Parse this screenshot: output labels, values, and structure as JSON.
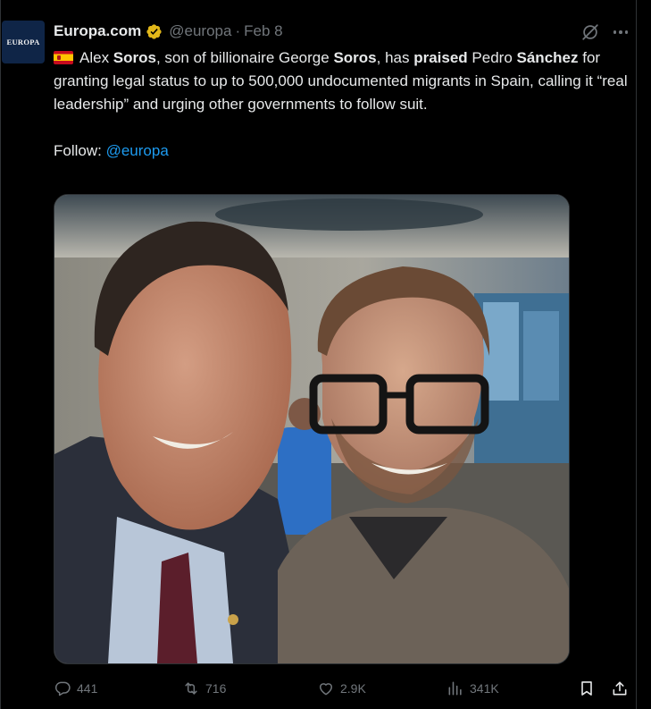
{
  "author": {
    "avatar_text": "EUROPA",
    "name": "Europa.com",
    "handle": "@europa",
    "separator": "·",
    "date": "Feb 8"
  },
  "tweet": {
    "t1": "Alex ",
    "t2": "Soros",
    "t3": ", son of billionaire George ",
    "t4": "Soros",
    "t5": ", has ",
    "t6": "praised",
    "t7": " Pedro ",
    "t8": "Sánchez",
    "t9": " for granting legal status to up to 500,000 undocumented migrants in Spain, calling it “real leadership” and urging other governments to follow suit.",
    "follow_label": "Follow: ",
    "follow_mention": "@europa"
  },
  "icons": {
    "flag": "spain-flag-icon",
    "verified": "verified-badge-icon",
    "grok": "grok-icon",
    "more": "more-icon",
    "reply": "reply-icon",
    "repost": "repost-icon",
    "like": "like-icon",
    "views": "views-icon",
    "bookmark": "bookmark-icon",
    "share": "share-icon"
  },
  "metrics": {
    "replies": "441",
    "reposts": "716",
    "likes": "2.9K",
    "views": "341K"
  },
  "colors": {
    "background": "#000000",
    "text": "#e7e9ea",
    "muted": "#71767b",
    "link": "#1d9bf0",
    "verified": "#e2b719"
  }
}
